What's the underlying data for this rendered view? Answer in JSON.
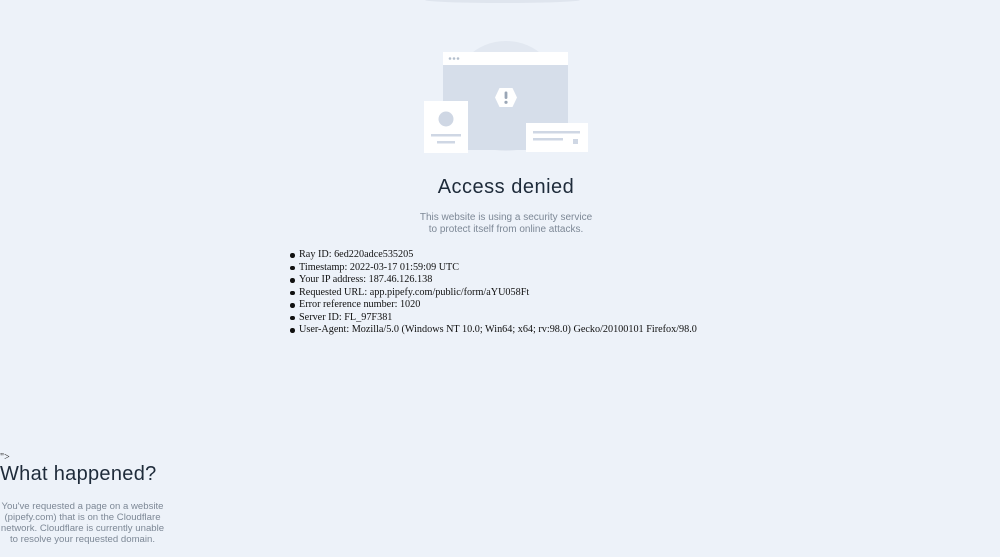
{
  "page": {
    "title": "Access denied",
    "subtitle_line1": "This website is using a security service",
    "subtitle_line2": "to protect itself from online attacks."
  },
  "details": [
    "Ray ID: 6ed220adce535205",
    "Timestamp: 2022-03-17 01:59:09 UTC",
    "Your IP address: 187.46.126.138",
    "Requested URL: app.pipefy.com/public/form/aYU058Ft",
    "Error reference number: 1020",
    "Server ID: FL_97F381",
    "User-Agent: Mozilla/5.0 (Windows NT 10.0; Win64; x64; rv:98.0) Gecko/20100101 Firefox/98.0"
  ],
  "stray_text": "\">",
  "what_happened": {
    "heading": "What happened?",
    "line1": "You've requested a page on a website",
    "line2": "(pipefy.com) that is on the Cloudflare",
    "line3": "network. Cloudflare is currently unable",
    "line4": "to resolve your requested domain."
  },
  "icons": {
    "illustration": "blocked-browser-illustration",
    "warning": "warning-hexagon-icon"
  },
  "colors": {
    "background": "#edf2f9",
    "illustration_circle": "#e2e8f1",
    "illustration_window": "#d6deea",
    "card": "#ffffff",
    "heading_text": "#1e2b3a",
    "muted_text": "#7d8896"
  }
}
